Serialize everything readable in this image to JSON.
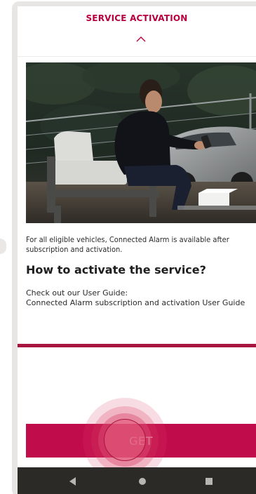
{
  "header": {
    "title": "SERVICE ACTIVATION",
    "collapse_icon": "chevron-up-icon"
  },
  "hero_image": {
    "icon": "photo-man-with-phone-on-terrace"
  },
  "content": {
    "intro": "For all eligible vehicles, Connected Alarm is available after subscription and activation.",
    "section_title": "How to activate the service?",
    "guide_label": "Check out our User Guide:",
    "guide_link": "Connected Alarm subscription and activation User Guide"
  },
  "cta": {
    "get_label": "GET"
  },
  "navbar": {
    "back_icon": "back-triangle-icon",
    "home_icon": "home-circle-icon",
    "recent_icon": "recent-apps-square-icon"
  },
  "colors": {
    "accent": "#c10c4b",
    "divider": "#a8163f",
    "navbar": "#2b2a27"
  }
}
